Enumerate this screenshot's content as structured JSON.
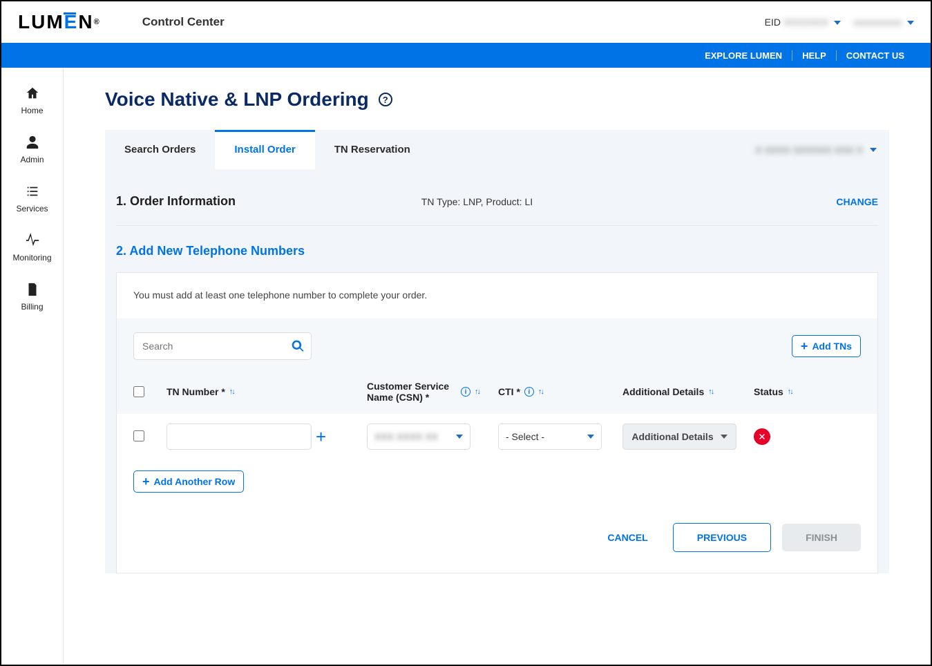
{
  "header": {
    "logo_text_1": "LUM",
    "logo_text_2": "E",
    "logo_text_3": "N",
    "app_title": "Control Center",
    "eid_label": "EID",
    "eid_value": "XXXXXXX",
    "user_label": "xxxxxxxxxx"
  },
  "topnav": {
    "explore": "EXPLORE LUMEN",
    "help": "HELP",
    "contact": "CONTACT US"
  },
  "sidebar": {
    "home": "Home",
    "admin": "Admin",
    "services": "Services",
    "monitoring": "Monitoring",
    "billing": "Billing"
  },
  "page": {
    "title": "Voice Native & LNP Ordering",
    "help_glyph": "?"
  },
  "tabs": {
    "search": "Search Orders",
    "install": "Install Order",
    "tnres": "TN Reservation",
    "context_label": "X XXXX XXXXXX XXX X"
  },
  "step1": {
    "title": "1. Order Information",
    "meta": "TN Type: LNP, Product: LI",
    "change": "CHANGE"
  },
  "step2": {
    "title": "2. Add New Telephone Numbers",
    "instruction": "You must add at least one telephone number to complete your order.",
    "search_placeholder": "Search",
    "add_tns": "Add TNs",
    "cols": {
      "tn": "TN Number *",
      "csn": "Customer Service Name (CSN) *",
      "cti": "CTI *",
      "addl": "Additional Details",
      "status": "Status"
    },
    "row": {
      "tn_value": "",
      "csn_value": "XXX XXXX XX",
      "cti_value": "- Select -",
      "addl_label": "Additional Details"
    },
    "add_row": "Add Another Row",
    "cancel": "CANCEL",
    "previous": "PREVIOUS",
    "finish": "FINISH"
  }
}
